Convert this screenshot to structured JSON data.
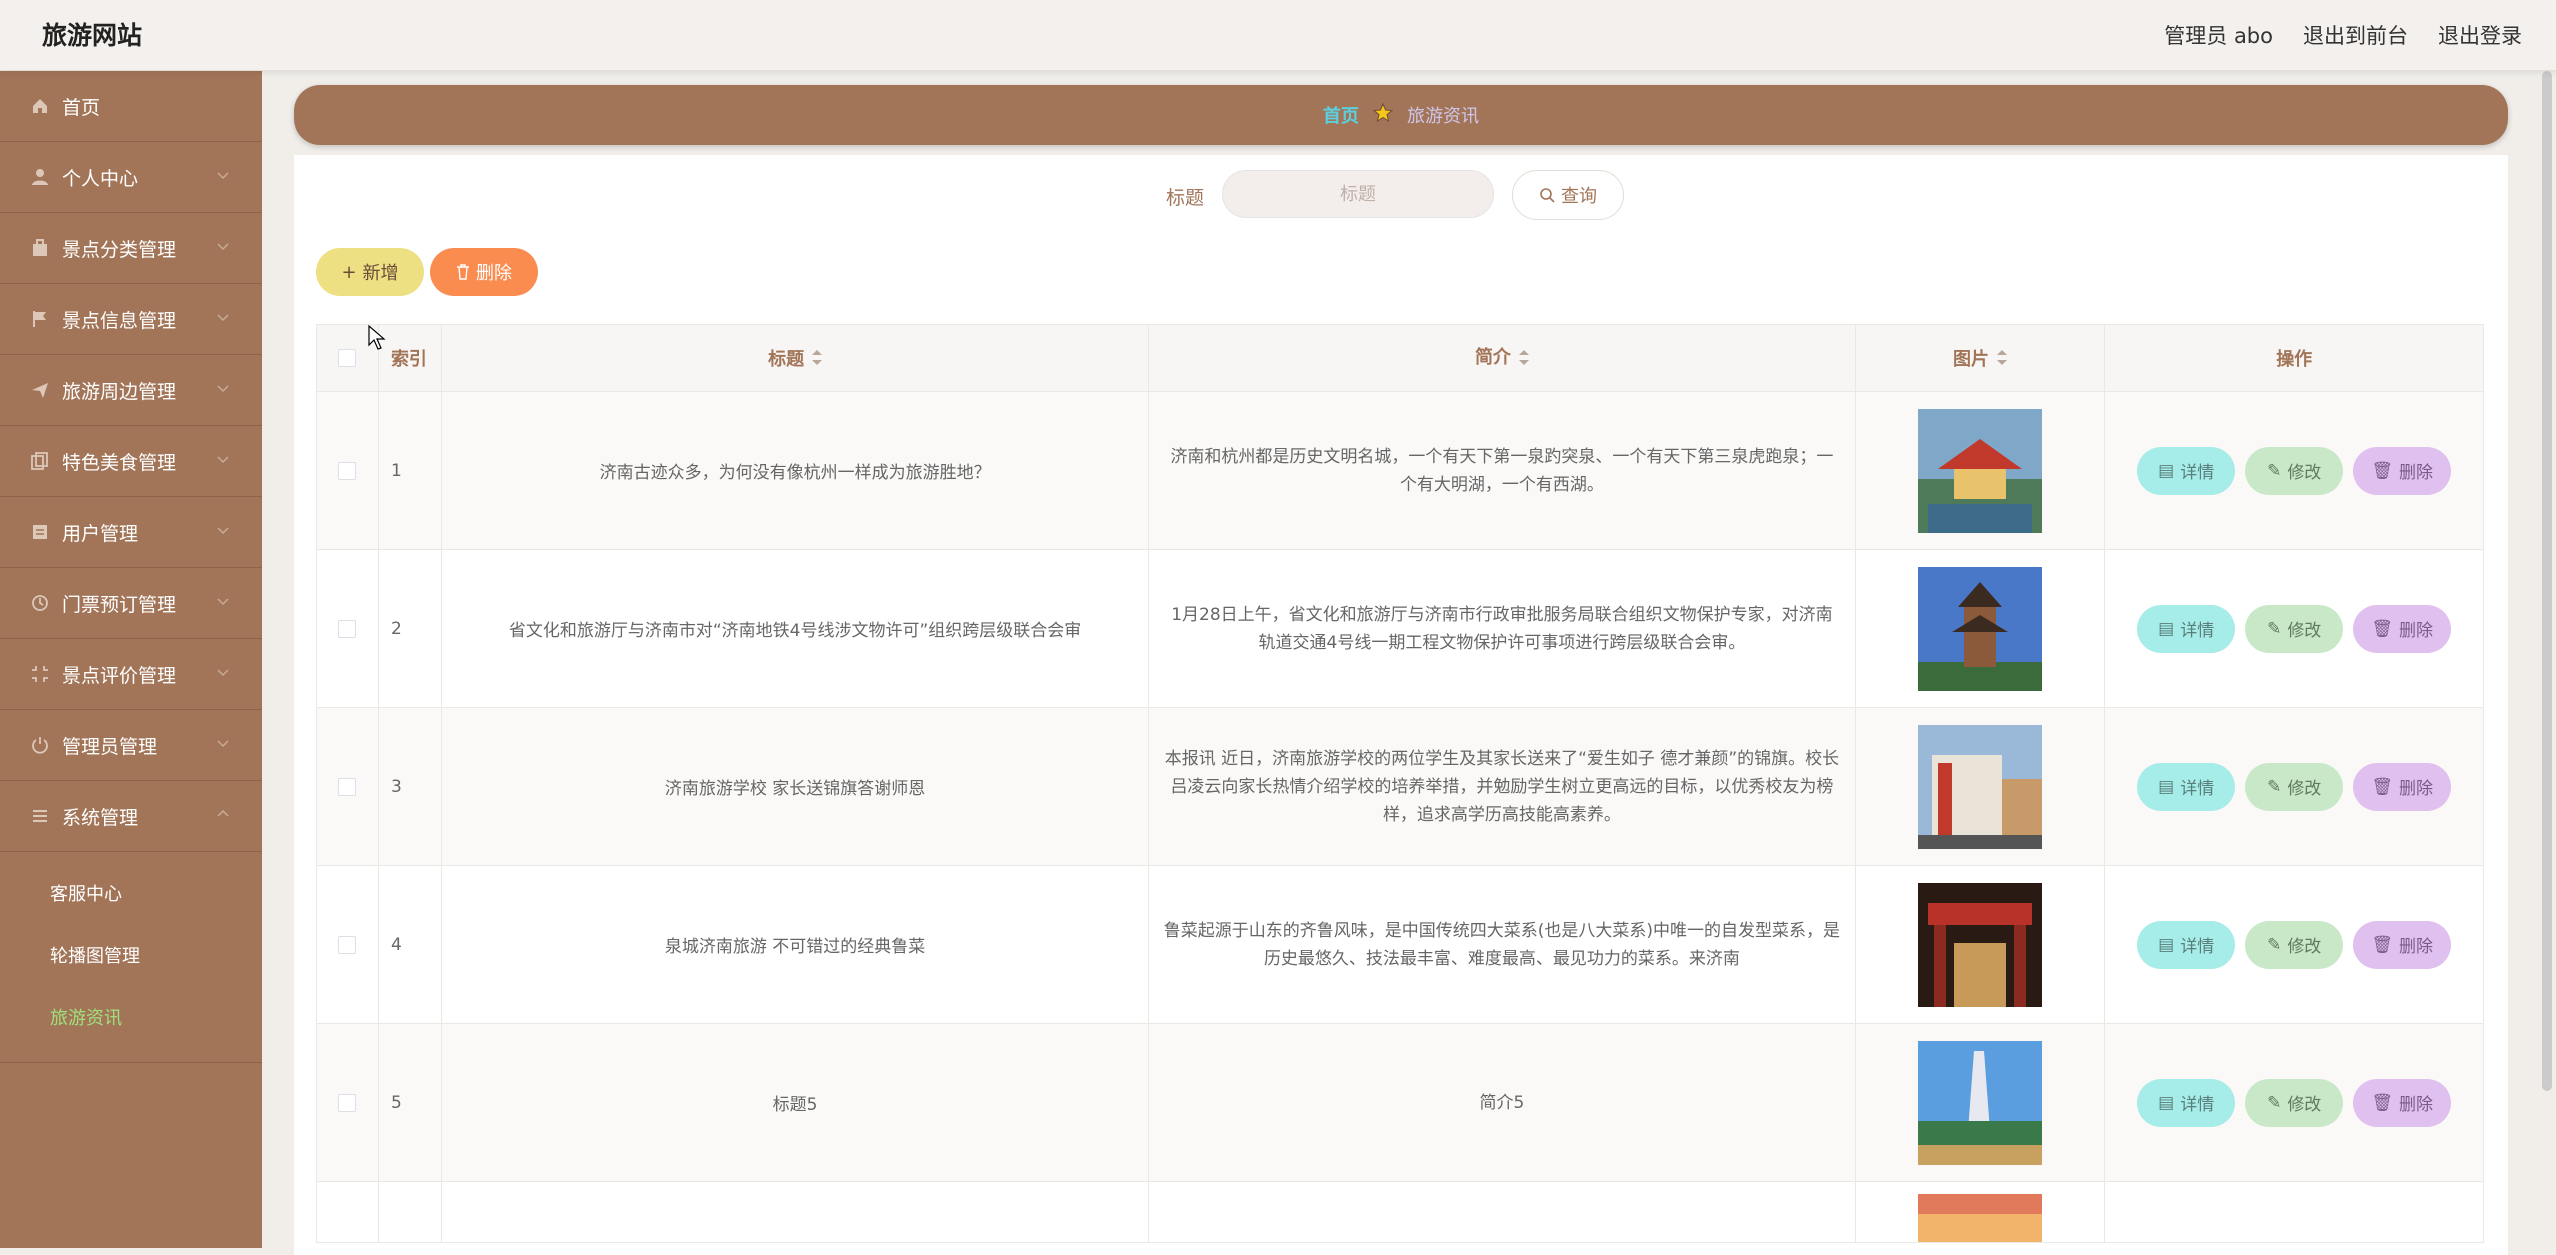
{
  "app": {
    "brand": "旅游网站"
  },
  "topnav": {
    "admin": "管理员 abo",
    "front": "退出到前台",
    "logout": "退出登录"
  },
  "sidebar": {
    "items": [
      {
        "label": "首页",
        "icon": "home-icon"
      },
      {
        "label": "个人中心",
        "icon": "user-icon"
      },
      {
        "label": "景点分类管理",
        "icon": "bag-icon"
      },
      {
        "label": "景点信息管理",
        "icon": "flag-icon"
      },
      {
        "label": "旅游周边管理",
        "icon": "send-icon"
      },
      {
        "label": "特色美食管理",
        "icon": "copy-icon"
      },
      {
        "label": "用户管理",
        "icon": "list-icon"
      },
      {
        "label": "门票预订管理",
        "icon": "clock-icon"
      },
      {
        "label": "景点评价管理",
        "icon": "crop-icon"
      },
      {
        "label": "管理员管理",
        "icon": "power-icon"
      },
      {
        "label": "系统管理",
        "icon": "menu-icon"
      }
    ],
    "sub": [
      "客服中心",
      "轮播图管理",
      "旅游资讯"
    ]
  },
  "breadcrumb": {
    "home": "首页",
    "current": "旅游资讯"
  },
  "search": {
    "label": "标题",
    "placeholder": "标题",
    "button": "查询"
  },
  "actions": {
    "add": "新增",
    "delete": "删除"
  },
  "table": {
    "headers": {
      "index": "索引",
      "title": "标题",
      "intro": "简介",
      "image": "图片",
      "ops": "操作"
    },
    "ops": {
      "detail": "详情",
      "edit": "修改",
      "delete": "删除"
    },
    "rows": [
      {
        "index": "1",
        "title": "济南古迹众多，为何没有像杭州一样成为旅游胜地？",
        "intro": "济南和杭州都是历史文明名城，一个有天下第一泉趵突泉、一个有天下第三泉虎跑泉；一个有大明湖，一个有西湖。"
      },
      {
        "index": "2",
        "title": "省文化和旅游厅与济南市对“济南地铁4号线涉文物许可”组织跨层级联合会审",
        "intro": "1月28日上午，省文化和旅游厅与济南市行政审批服务局联合组织文物保护专家，对济南轨道交通4号线一期工程文物保护许可事项进行跨层级联合会审。"
      },
      {
        "index": "3",
        "title": "济南旅游学校 家长送锦旗答谢师恩",
        "intro": "本报讯 近日，济南旅游学校的两位学生及其家长送来了“爱生如子 德才兼颜”的锦旗。校长吕凌云向家长热情介绍学校的培养举措，并勉励学生树立更高远的目标，以优秀校友为榜样，追求高学历高技能高素养。"
      },
      {
        "index": "4",
        "title": "泉城济南旅游 不可错过的经典鲁菜",
        "intro": "鲁菜起源于山东的齐鲁风味，是中国传统四大菜系(也是八大菜系)中唯一的自发型菜系，是历史最悠久、技法最丰富、难度最高、最见功力的菜系。来济南"
      },
      {
        "index": "5",
        "title": "标题5",
        "intro": "简介5"
      }
    ]
  },
  "colors": {
    "brand": "#a27558",
    "accent": "#9fe17c"
  }
}
